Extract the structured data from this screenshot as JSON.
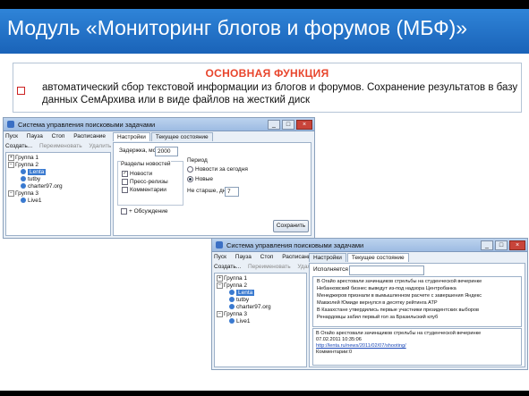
{
  "slide": {
    "title": "Модуль «Мониторинг блогов и форумов (МБФ)»",
    "function_heading": "ОСНОВНАЯ ФУНКЦИЯ",
    "function_text": "автоматический сбор текстовой информации из блогов и форумов. Сохранение результатов в базу данных СемАрхива или в виде файлов на жесткий диск"
  },
  "window": {
    "title": "Система управления поисковыми задачами",
    "minimize": "_",
    "maximize": "□",
    "close": "×",
    "menu": [
      "Пуск",
      "Пауза",
      "Стоп",
      "Расписание"
    ],
    "toolbar": {
      "create": "Создать...",
      "rename": "Переименовать",
      "delete": "Удалить"
    },
    "tree": {
      "group1": "Группа 1",
      "group2": "Группа 2",
      "items": [
        "Lenta",
        "tutby",
        "charter97.org"
      ],
      "group3": "Группа 3",
      "group3_item": "Live1"
    },
    "tabs": {
      "settings": "Настройки",
      "status": "Текущее состояние"
    },
    "settings": {
      "delay_label": "Задержка, мс",
      "delay_value": "2000",
      "sections_label": "Разделы новостей",
      "section_news": "Новости",
      "section_press": "Пресс-релизы",
      "section_comments": "Комментарии",
      "discussion": "+ Обсуждение",
      "period_label": "Период",
      "period_today": "Новости за сегодня",
      "period_new": "Новые",
      "older_label": "Не старше, дн.",
      "older_value": "7",
      "save": "Сохранить"
    },
    "status": {
      "executing_label": "Исполняется",
      "log_lines": [
        "В Огайо арестовали зачинщиков стрельбы на студенческой вечеринке",
        "Небанковский бизнес выведут из-под надзора Центробанка",
        "Менеджеров признали в вымышленном расчете с завершения Яндекс",
        "Мавзолей Юмиде вернулся в десятку рейтинга АТР",
        "В Казахстане утвердились первые участники президентских выборов",
        "Ренардовцы забил первый гол за Бразильский клуб"
      ],
      "detail_headline": "В Огайо арестовали зачинщиков стрельбы на студенческой вечеринке",
      "detail_date": "07.02.2011 10:35:06",
      "detail_link": "http://lenta.ru/news/2011/02/07/shooting/",
      "comments_label": "Комментарии:",
      "comments_value": "0"
    }
  }
}
